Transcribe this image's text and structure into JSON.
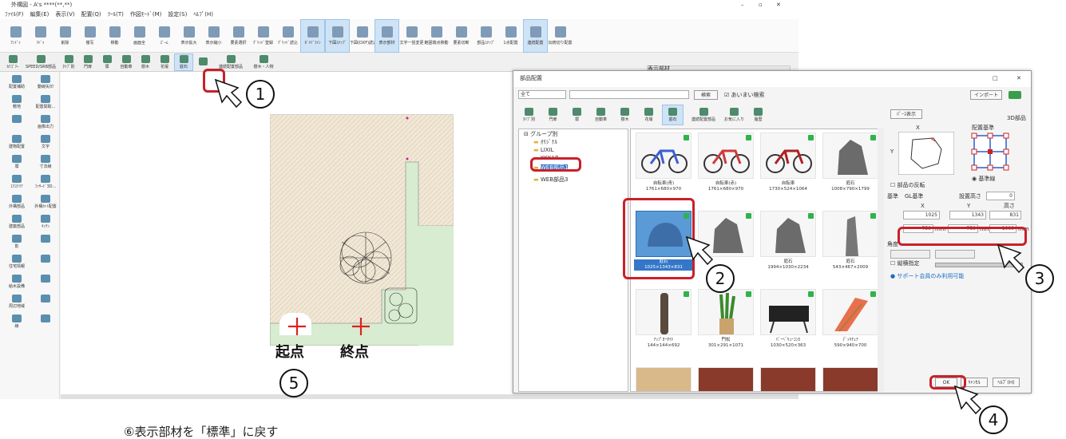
{
  "app": {
    "title": "外構図 - A's ****(**,**)",
    "menu": [
      "ﾌｧｲﾙ(F)",
      "編集(E)",
      "表示(V)",
      "配置(Q)",
      "ﾂｰﾙ(T)",
      "作図ﾓｰﾄﾞ(M)",
      "設定(S)",
      "ﾍﾙﾌﾟ(H)"
    ],
    "ribbon": [
      {
        "label": "ｱﾝﾄﾞｩ",
        "active": false
      },
      {
        "label": "ﾘﾄﾞｩ",
        "active": false
      },
      {
        "label": "削除",
        "active": false
      },
      {
        "label": "複写",
        "active": false
      },
      {
        "label": "移動",
        "active": false
      },
      {
        "label": "画面全",
        "active": false
      },
      {
        "label": "ｽﾞｰﾑ",
        "active": false
      },
      {
        "label": "表示拡大",
        "active": false
      },
      {
        "label": "表示縮小",
        "active": false
      },
      {
        "label": "要素選択",
        "active": false
      },
      {
        "label": "ｸﾞﾘｯﾄﾞ登録",
        "active": false
      },
      {
        "label": "ｸﾞﾘｯﾄﾞ読込",
        "active": false
      },
      {
        "label": "ｶﾞｲﾄﾞﾗｲﾝ",
        "active": true
      },
      {
        "label": "下図ｽﾅｯﾌﾟ",
        "active": true
      },
      {
        "label": "下図(DXF)読込",
        "active": false
      },
      {
        "label": "表示部材",
        "active": true
      },
      {
        "label": "文字一括変更",
        "active": false
      },
      {
        "label": "範囲端点移動",
        "active": false
      },
      {
        "label": "要素切断",
        "active": false
      },
      {
        "label": "部品ｽﾅｯﾌﾟ",
        "active": false
      },
      {
        "label": "1点配置",
        "active": false
      },
      {
        "label": "連続配置",
        "active": true
      },
      {
        "label": "伝統切り配置",
        "active": false
      }
    ],
    "toolbar2": [
      {
        "label": "ｶﾃｺﾞﾘｰ",
        "active": false
      },
      {
        "label": "SPEED/SRB部品",
        "active": false
      },
      {
        "label": "ﾀｲﾌﾟ別",
        "active": false
      },
      {
        "label": "門扉",
        "active": false
      },
      {
        "label": "塀",
        "active": false
      },
      {
        "label": "自動車",
        "active": false
      },
      {
        "label": "樹木",
        "active": false
      },
      {
        "label": "花壇",
        "active": false
      },
      {
        "label": "庭石",
        "active": true
      },
      {
        "label": "",
        "active": false
      },
      {
        "label": "連続配置部品",
        "active": false
      },
      {
        "label": "樹木・人物",
        "active": false
      }
    ],
    "leftbar": [
      [
        "配置補助",
        "動線矢印"
      ],
      [
        "敷地",
        "配置間取..."
      ],
      [
        "",
        "画像出力"
      ],
      [
        "建物配置",
        "文字"
      ],
      [
        "塀",
        "寸法線"
      ],
      [
        "ｴｸｽﾃﾘｱ",
        "ﾌｧｻｰﾄﾞ3D..."
      ],
      [
        "外構部品",
        "外構ｶｯﾄ配置"
      ],
      [
        "建築部品",
        "ｷｯﾁﾝ"
      ],
      [
        "影",
        ""
      ],
      [
        "住宅情報",
        ""
      ],
      [
        "給水設備",
        ""
      ],
      [
        "周辺地域",
        ""
      ],
      [
        "線",
        ""
      ]
    ],
    "panel_tab": "表示部材"
  },
  "dialog": {
    "title": "部品配置",
    "filter_value": "全て",
    "search_button": "検索",
    "similar_search": "あいまい検索",
    "import_button": "インポート",
    "toolbar": [
      "ﾀｲﾌﾟ別",
      "門扉",
      "塀",
      "自動車",
      "樹木",
      "花壇",
      "庭石",
      "連続配置部品",
      "お気に入り",
      "履歴"
    ],
    "tree": {
      "root": "グループ別",
      "items": [
        "ｵﾘｼﾞﾅﾙ",
        "LIXIL",
        "YKKAP",
        "WEB部品1",
        "WEB部品3"
      ],
      "selected": "WEB部品1"
    },
    "parts": [
      {
        "name": "自転車(青)",
        "size": "1761×680×970",
        "selected": false
      },
      {
        "name": "自転車(赤)",
        "size": "1761×680×970",
        "selected": false
      },
      {
        "name": "自転車",
        "size": "1730×524×1064",
        "selected": false
      },
      {
        "name": "庭石",
        "size": "1008×790×1799",
        "selected": false
      },
      {
        "name": "庭石",
        "size": "1025×1343×831",
        "selected": true
      },
      {
        "name": "",
        "size": "",
        "selected": false
      },
      {
        "name": "庭石",
        "size": "1994×1030×2234",
        "selected": false
      },
      {
        "name": "庭石",
        "size": "543×467×2009",
        "selected": false
      },
      {
        "name": "ｱｯﾌﾟﾛｰﾀｲﾄ",
        "size": "144×144×692",
        "selected": false
      },
      {
        "name": "門松",
        "size": "301×291×1071",
        "selected": false
      },
      {
        "name": "ﾊﾞｰﾍﾞｷｭｰｺﾝﾛ",
        "size": "1030×520×363",
        "selected": false
      },
      {
        "name": "ﾃﾞｯｷﾁｪｱ",
        "size": "590×940×700",
        "selected": false
      }
    ],
    "right": {
      "tab": "ﾊﾟｰｽ表示",
      "label_web": "3D部品",
      "axis_x": "X",
      "axis_y": "Y",
      "placement_base": "配置基準",
      "flip": "部品の反転",
      "base_label": "基準",
      "base_value": "GL基準",
      "install_height_label": "設置高さ",
      "install_height": "0",
      "col_x": "X",
      "col_y": "Y",
      "col_h": "高さ",
      "orig_x": "1025",
      "orig_y": "1343",
      "orig_h": "831",
      "new_x": "750",
      "new_y": "750",
      "new_h": "1000",
      "unit": "mm",
      "rotation_label": "角度",
      "keep_ratio": "縦横指定",
      "support_note": "サポート会員のみ利用可能",
      "standard_option": "基準線"
    },
    "buttons": {
      "ok": "OK",
      "cancel": "ｷｬﾝｾﾙ",
      "help": "ﾍﾙﾌﾟ(H)"
    }
  },
  "annotations": {
    "steps": [
      "1",
      "2",
      "3",
      "4",
      "5"
    ],
    "start_label": "起点",
    "end_label": "終点"
  },
  "footnote": "⑥表示部材を「標準」に戻す"
}
